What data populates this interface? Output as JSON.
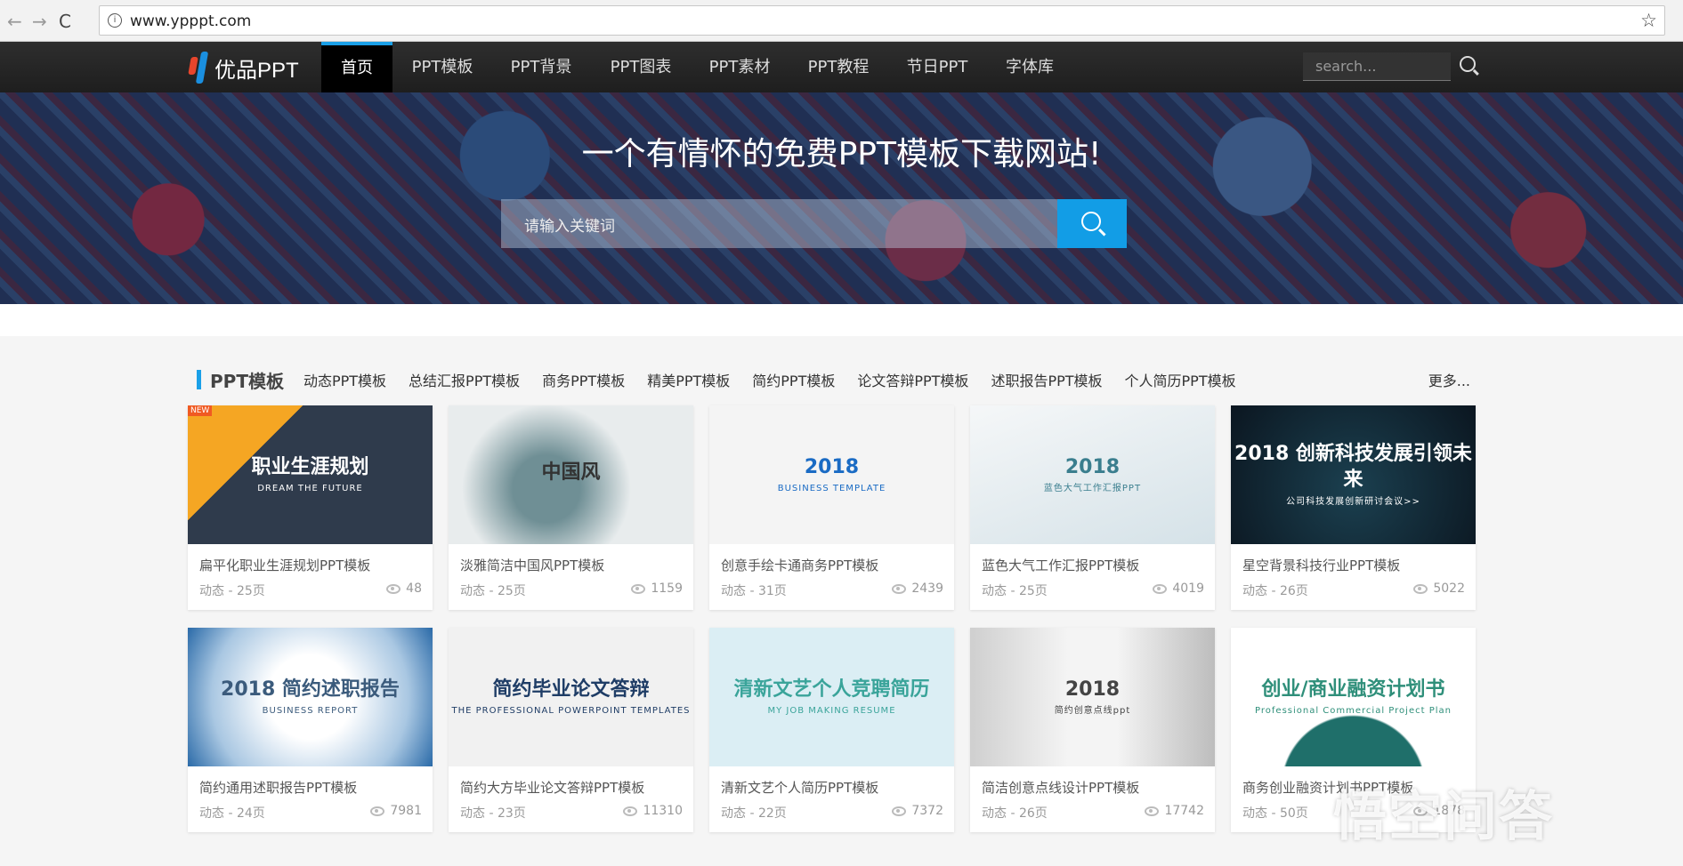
{
  "browser": {
    "url": "www.ypppt.com",
    "back": "←",
    "forward": "→",
    "reload": "C",
    "star": "☆",
    "info": "i"
  },
  "nav": {
    "logo": "优品PPT",
    "items": [
      "首页",
      "PPT模板",
      "PPT背景",
      "PPT图表",
      "PPT素材",
      "PPT教程",
      "节日PPT",
      "字体库"
    ],
    "search_placeholder": "search..."
  },
  "banner": {
    "title": "一个有情怀的免费PPT模板下载网站!",
    "search_placeholder": "请输入关键词"
  },
  "section": {
    "title": "PPT模板",
    "categories": [
      "动态PPT模板",
      "总结汇报PPT模板",
      "商务PPT模板",
      "精美PPT模板",
      "简约PPT模板",
      "论文答辩PPT模板",
      "述职报告PPT模板",
      "个人简历PPT模板"
    ],
    "more": "更多..."
  },
  "cards": [
    {
      "title": "扁平化职业生涯规划PPT模板",
      "meta": "动态 - 25页",
      "views": "48",
      "thumb": "职业生涯规划",
      "sub": "DREAM   THE FUTURE",
      "badge": "NEW"
    },
    {
      "title": "淡雅简洁中国风PPT模板",
      "meta": "动态 - 25页",
      "views": "1159",
      "thumb": "中国风",
      "sub": ""
    },
    {
      "title": "创意手绘卡通商务PPT模板",
      "meta": "动态 - 31页",
      "views": "2439",
      "thumb": "2018",
      "sub": "BUSINESS TEMPLATE"
    },
    {
      "title": "蓝色大气工作汇报PPT模板",
      "meta": "动态 - 25页",
      "views": "4019",
      "thumb": "2018",
      "sub": "蓝色大气工作汇报PPT"
    },
    {
      "title": "星空背景科技行业PPT模板",
      "meta": "动态 - 26页",
      "views": "5022",
      "thumb": "2018 创新科技发展引领未来",
      "sub": "公司科技发展创新研讨会议>>"
    },
    {
      "title": "简约通用述职报告PPT模板",
      "meta": "动态 - 24页",
      "views": "7981",
      "thumb": "2018 简约述职报告",
      "sub": "BUSINESS REPORT"
    },
    {
      "title": "简约大方毕业论文答辩PPT模板",
      "meta": "动态 - 23页",
      "views": "11310",
      "thumb": "简约毕业论文答辩",
      "sub": "THE PROFESSIONAL POWERPOINT TEMPLATES"
    },
    {
      "title": "清新文艺个人简历PPT模板",
      "meta": "动态 - 22页",
      "views": "7372",
      "thumb": "清新文艺个人竞聘简历",
      "sub": "MY JOB MAKING RESUME"
    },
    {
      "title": "简洁创意点线设计PPT模板",
      "meta": "动态 - 26页",
      "views": "17742",
      "thumb": "2018",
      "sub": "简约创意点线ppt"
    },
    {
      "title": "商务创业融资计划书PPT模板",
      "meta": "动态 - 50页",
      "views": "1878",
      "thumb": "创业/商业融资计划书",
      "sub": "Professional Commercial Project Plan"
    }
  ],
  "watermark": "悟空问答"
}
